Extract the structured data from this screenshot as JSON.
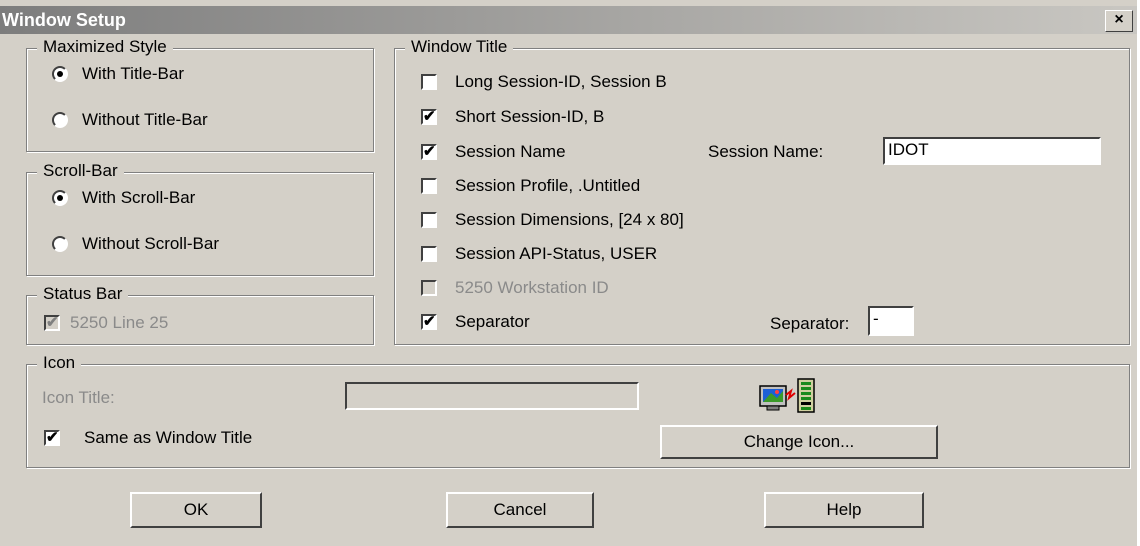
{
  "window": {
    "title": "Window Setup",
    "close_glyph": "×"
  },
  "maximized_style": {
    "legend": "Maximized Style",
    "options": [
      {
        "label": "With Title-Bar",
        "selected": true
      },
      {
        "label": "Without Title-Bar",
        "selected": false
      }
    ]
  },
  "scroll_bar": {
    "legend": "Scroll-Bar",
    "options": [
      {
        "label": "With Scroll-Bar",
        "selected": true
      },
      {
        "label": "Without Scroll-Bar",
        "selected": false
      }
    ]
  },
  "status_bar": {
    "legend": "Status Bar",
    "line25": {
      "label": "5250 Line 25",
      "checked": true,
      "disabled": true
    }
  },
  "window_title": {
    "legend": "Window Title",
    "items": [
      {
        "label": "Long Session-ID,  Session B",
        "checked": false,
        "disabled": false
      },
      {
        "label": "Short Session-ID,  B",
        "checked": true,
        "disabled": false
      },
      {
        "label": "Session Name",
        "checked": true,
        "disabled": false
      },
      {
        "label": "Session Profile,  .Untitled",
        "checked": false,
        "disabled": false
      },
      {
        "label": "Session Dimensions,  [24 x 80]",
        "checked": false,
        "disabled": false
      },
      {
        "label": "Session API-Status,  USER",
        "checked": false,
        "disabled": false
      },
      {
        "label": "5250 Workstation ID",
        "checked": false,
        "disabled": true
      },
      {
        "label": "Separator",
        "checked": true,
        "disabled": false
      }
    ],
    "session_name_label": "Session Name:",
    "session_name_value": "IDOT",
    "separator_label": "Separator:",
    "separator_value": "-"
  },
  "icon": {
    "legend": "Icon",
    "icon_title_label": "Icon Title:",
    "icon_title_value": "",
    "same_as_title_label": "Same as Window Title",
    "same_as_title_checked": true,
    "change_icon_label": "Change Icon...",
    "preview_icon": "session-monitor-icon"
  },
  "buttons": {
    "ok": "OK",
    "cancel": "Cancel",
    "help": "Help"
  },
  "check_glyph": "✔"
}
